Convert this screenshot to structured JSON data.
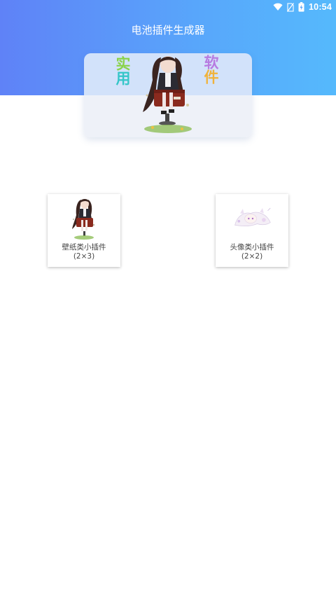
{
  "status_bar": {
    "time": "10:54",
    "icons": [
      "wifi-icon",
      "no-sim-icon",
      "battery-charging-icon"
    ]
  },
  "app": {
    "title": "电池插件生成器"
  },
  "banner": {
    "left_text": [
      "实",
      "用"
    ],
    "right_text": [
      "软",
      "件"
    ]
  },
  "widgets": [
    {
      "label": "壁纸类小插件",
      "size": "(2×3)",
      "thumb": "anime-girl-wallpaper"
    },
    {
      "label": "头像类小插件",
      "size": "(2×2)",
      "thumb": "anime-girl-avatar"
    }
  ],
  "colors": {
    "header_gradient_start": "#5f82f7",
    "header_gradient_end": "#55b9fc",
    "banner_text_1": "#8ad24a",
    "banner_text_2": "#35c6c8",
    "banner_text_3": "#b77be0",
    "banner_text_4": "#f0b23a"
  }
}
